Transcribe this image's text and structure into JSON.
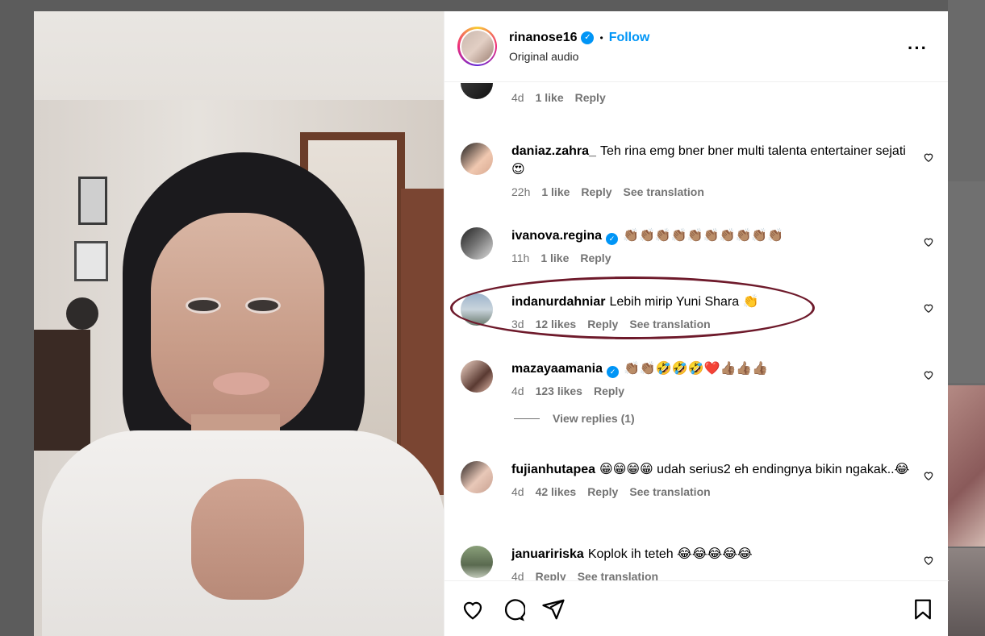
{
  "post": {
    "username": "rinanose16",
    "verified_mark": "✓",
    "separator": "•",
    "follow_label": "Follow",
    "audio": "Original audio",
    "more_label": "···"
  },
  "comments": [
    {
      "user": "",
      "text": "",
      "time": "4d",
      "likes": "1 like",
      "reply": "Reply",
      "translation": ""
    },
    {
      "user": "daniaz.zahra_",
      "text": "Teh rina emg bner bner multi talenta entertainer sejati 😍",
      "time": "22h",
      "likes": "1 like",
      "reply": "Reply",
      "translation": "See translation"
    },
    {
      "user": "ivanova.regina",
      "verified": true,
      "text": "👏🏽👏🏽👏🏽👏🏽👏🏽👏🏽👏🏽👏🏽👏🏽👏🏽",
      "time": "11h",
      "likes": "1 like",
      "reply": "Reply",
      "translation": ""
    },
    {
      "user": "indanurdahniar",
      "text": "Lebih mirip Yuni Shara 👏",
      "time": "3d",
      "likes": "12 likes",
      "reply": "Reply",
      "translation": "See translation"
    },
    {
      "user": "mazayaamania",
      "verified": true,
      "text": "👏🏽👏🏽🤣🤣🤣❤️👍🏽👍🏽👍🏽",
      "time": "4d",
      "likes": "123 likes",
      "reply": "Reply",
      "translation": ""
    },
    {
      "user": "fujianhutapea",
      "text": "😁😁😁😁 udah serius2 eh endingnya bikin ngakak..😂",
      "time": "4d",
      "likes": "42 likes",
      "reply": "Reply",
      "translation": "See translation"
    },
    {
      "user": "januaririska",
      "text": "Koplok ih teteh 😂😂😂😂😂",
      "time": "4d",
      "likes": "",
      "reply": "Reply",
      "translation": "See translation"
    }
  ],
  "view_replies": "View replies (1)",
  "icons": {
    "heart": "heart-icon",
    "comment": "comment-icon",
    "share": "share-icon",
    "save": "bookmark-icon"
  },
  "colors": {
    "accent": "#0095f6",
    "annotation": "#6e1a2b"
  }
}
